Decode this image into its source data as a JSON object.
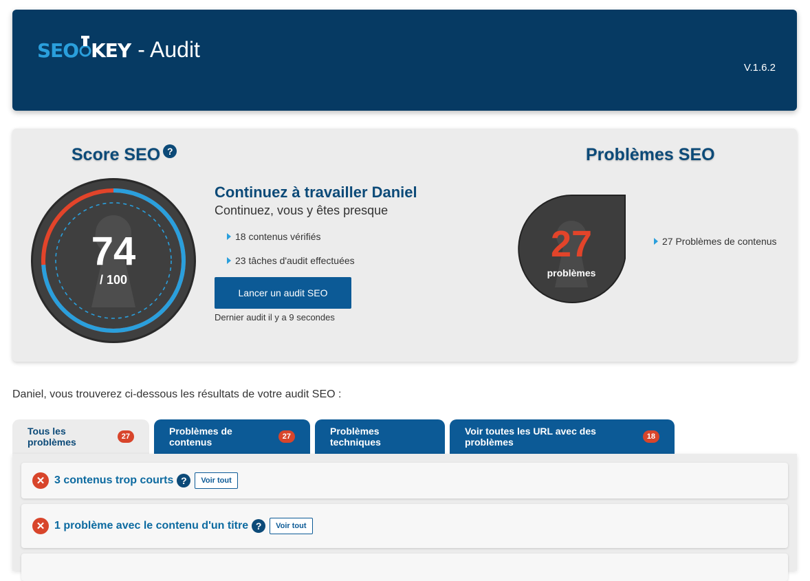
{
  "header": {
    "logo_seo": "SEO",
    "logo_key": "KEY",
    "title_suffix": "- Audit",
    "version": "V.1.6.2"
  },
  "score": {
    "title": "Score SEO",
    "help": "?",
    "value": "74",
    "max": "/ 100",
    "value_fraction": 0.74
  },
  "message": {
    "title": "Continuez à travailler Daniel",
    "subtitle": "Continuez, vous y êtes presque",
    "stats": [
      "18 contenus vérifiés",
      "23 tâches d'audit effectuées"
    ],
    "button": "Lancer un audit SEO",
    "last_audit": "Dernier audit il y a 9 secondes"
  },
  "problems": {
    "title": "Problèmes SEO",
    "count": "27",
    "count_label": "problèmes",
    "stat": "27 Problèmes de contenus"
  },
  "intro": "Daniel, vous trouverez ci-dessous les résultats de votre audit SEO :",
  "tabs": [
    {
      "label": "Tous les problèmes",
      "badge": "27"
    },
    {
      "label": "Problèmes de contenus",
      "badge": "27"
    },
    {
      "label": "Problèmes techniques",
      "badge": ""
    },
    {
      "label": "Voir toutes les URL avec des problèmes",
      "badge": "18"
    }
  ],
  "issues": [
    {
      "label": "3 contenus trop courts",
      "help": "?",
      "button": "Voir tout"
    },
    {
      "label": "1 problème avec le contenu d'un titre",
      "help": "?",
      "button": "Voir tout"
    }
  ],
  "colors": {
    "primary": "#063a63",
    "accent": "#2a9fdc",
    "alert": "#d8452b"
  }
}
